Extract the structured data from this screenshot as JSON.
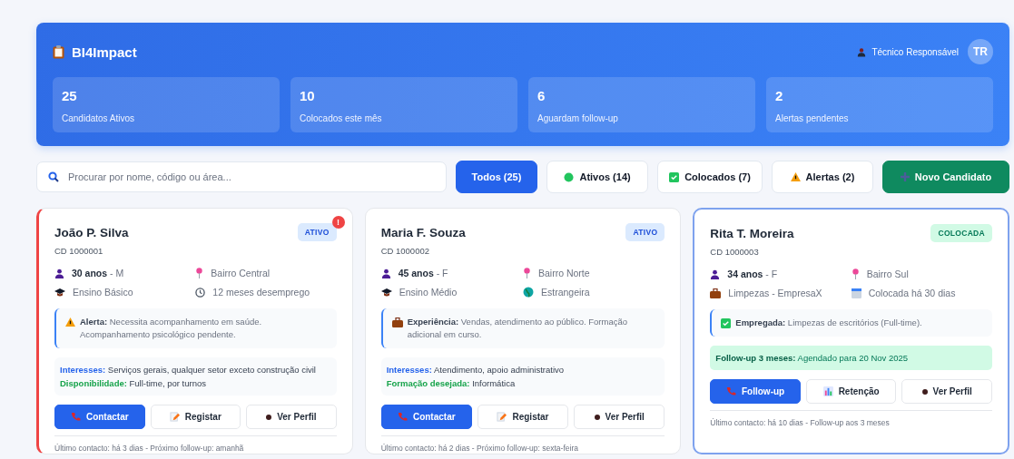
{
  "header": {
    "title": "BI4Impact",
    "user": "Técnico Responsável",
    "avatar": "TR"
  },
  "stats": [
    {
      "value": "25",
      "label": "Candidatos Ativos"
    },
    {
      "value": "10",
      "label": "Colocados este mês"
    },
    {
      "value": "6",
      "label": "Aguardam follow-up"
    },
    {
      "value": "2",
      "label": "Alertas pendentes"
    }
  ],
  "search": {
    "placeholder": "Procurar por nome, código ou área..."
  },
  "filters": [
    {
      "label": "Todos (25)",
      "kind": "plain",
      "selected": true
    },
    {
      "label": "Ativos (14)",
      "kind": "dot",
      "selected": false
    },
    {
      "label": "Colocados (7)",
      "kind": "check",
      "selected": false
    },
    {
      "label": "Alertas (2)",
      "kind": "warning",
      "selected": false
    }
  ],
  "new_button": {
    "label": "Novo Candidato"
  },
  "candidates": [
    {
      "name": "João P. Silva",
      "code": "CD 1000001",
      "status": {
        "label": "ATIVO",
        "kind": "active"
      },
      "alert": "!",
      "selected": false,
      "facts": [
        {
          "kind": "age",
          "text": "**30 anos** - M"
        },
        {
          "kind": "location",
          "text": "Bairro Central"
        },
        {
          "kind": "education",
          "text": "Ensino Básico"
        },
        {
          "kind": "unemployment",
          "text": "12 meses desemprego"
        }
      ],
      "note": {
        "kind": "alert",
        "text": "**Alerta:** Necessita acompanhamento em saúde. Acompanhamento psicológico pendente."
      },
      "details": [
        {
          "label": "Interesses:",
          "text": "Serviços gerais, qualquer setor exceto construção civil",
          "color": "#2563eb"
        },
        {
          "label": "Disponibilidade:",
          "text": "Full-time, por turnos",
          "color": "#16a34a"
        }
      ],
      "actions": [
        {
          "label": "Contactar",
          "kind": "contact"
        },
        {
          "label": "Registar",
          "kind": "register"
        },
        {
          "label": "Ver Perfil",
          "kind": "profile"
        }
      ],
      "footer": "Último contacto: há 3 dias - Próximo follow-up: amanhã"
    },
    {
      "name": "Maria F. Souza",
      "code": "CD 1000002",
      "status": {
        "label": "ATIVO",
        "kind": "active"
      },
      "selected": false,
      "facts": [
        {
          "kind": "age",
          "text": "**45 anos** - F"
        },
        {
          "kind": "location",
          "text": "Bairro Norte"
        },
        {
          "kind": "education",
          "text": "Ensino Médio"
        },
        {
          "kind": "nationality",
          "text": "Estrangeira"
        }
      ],
      "note": {
        "kind": "experience",
        "text": "**Experiência:** Vendas, atendimento ao público. Formação adicional em curso."
      },
      "details": [
        {
          "label": "Interesses:",
          "text": "Atendimento, apoio administrativo",
          "color": "#2563eb"
        },
        {
          "label": "Formação desejada:",
          "text": "Informática",
          "color": "#16a34a"
        }
      ],
      "actions": [
        {
          "label": "Contactar",
          "kind": "contact"
        },
        {
          "label": "Registar",
          "kind": "register"
        },
        {
          "label": "Ver Perfil",
          "kind": "profile"
        }
      ],
      "footer": "Último contacto: há 2 dias - Próximo follow-up: sexta-feira"
    },
    {
      "name": "Rita T. Moreira",
      "code": "CD 1000003",
      "status": {
        "label": "COLOCADA",
        "kind": "placed"
      },
      "selected": true,
      "facts": [
        {
          "kind": "age",
          "text": "**34 anos** - F"
        },
        {
          "kind": "location",
          "text": "Bairro Sul"
        },
        {
          "kind": "job",
          "text": "Limpezas - EmpresaX"
        },
        {
          "kind": "placement",
          "text": "Colocada há 30 dias"
        }
      ],
      "note": {
        "kind": "employed",
        "text": "**Empregada:** Limpezas de escritórios (Full-time)."
      },
      "followup": {
        "label": "Follow-up 3 meses:",
        "text": "Agendado para 20 Nov 2025"
      },
      "actions": [
        {
          "label": "Follow-up",
          "kind": "followup"
        },
        {
          "label": "Retenção",
          "kind": "retention"
        },
        {
          "label": "Ver Perfil",
          "kind": "profile"
        }
      ],
      "footer": "Último contacto: há 10 dias - Follow-up aos 3 meses"
    }
  ]
}
